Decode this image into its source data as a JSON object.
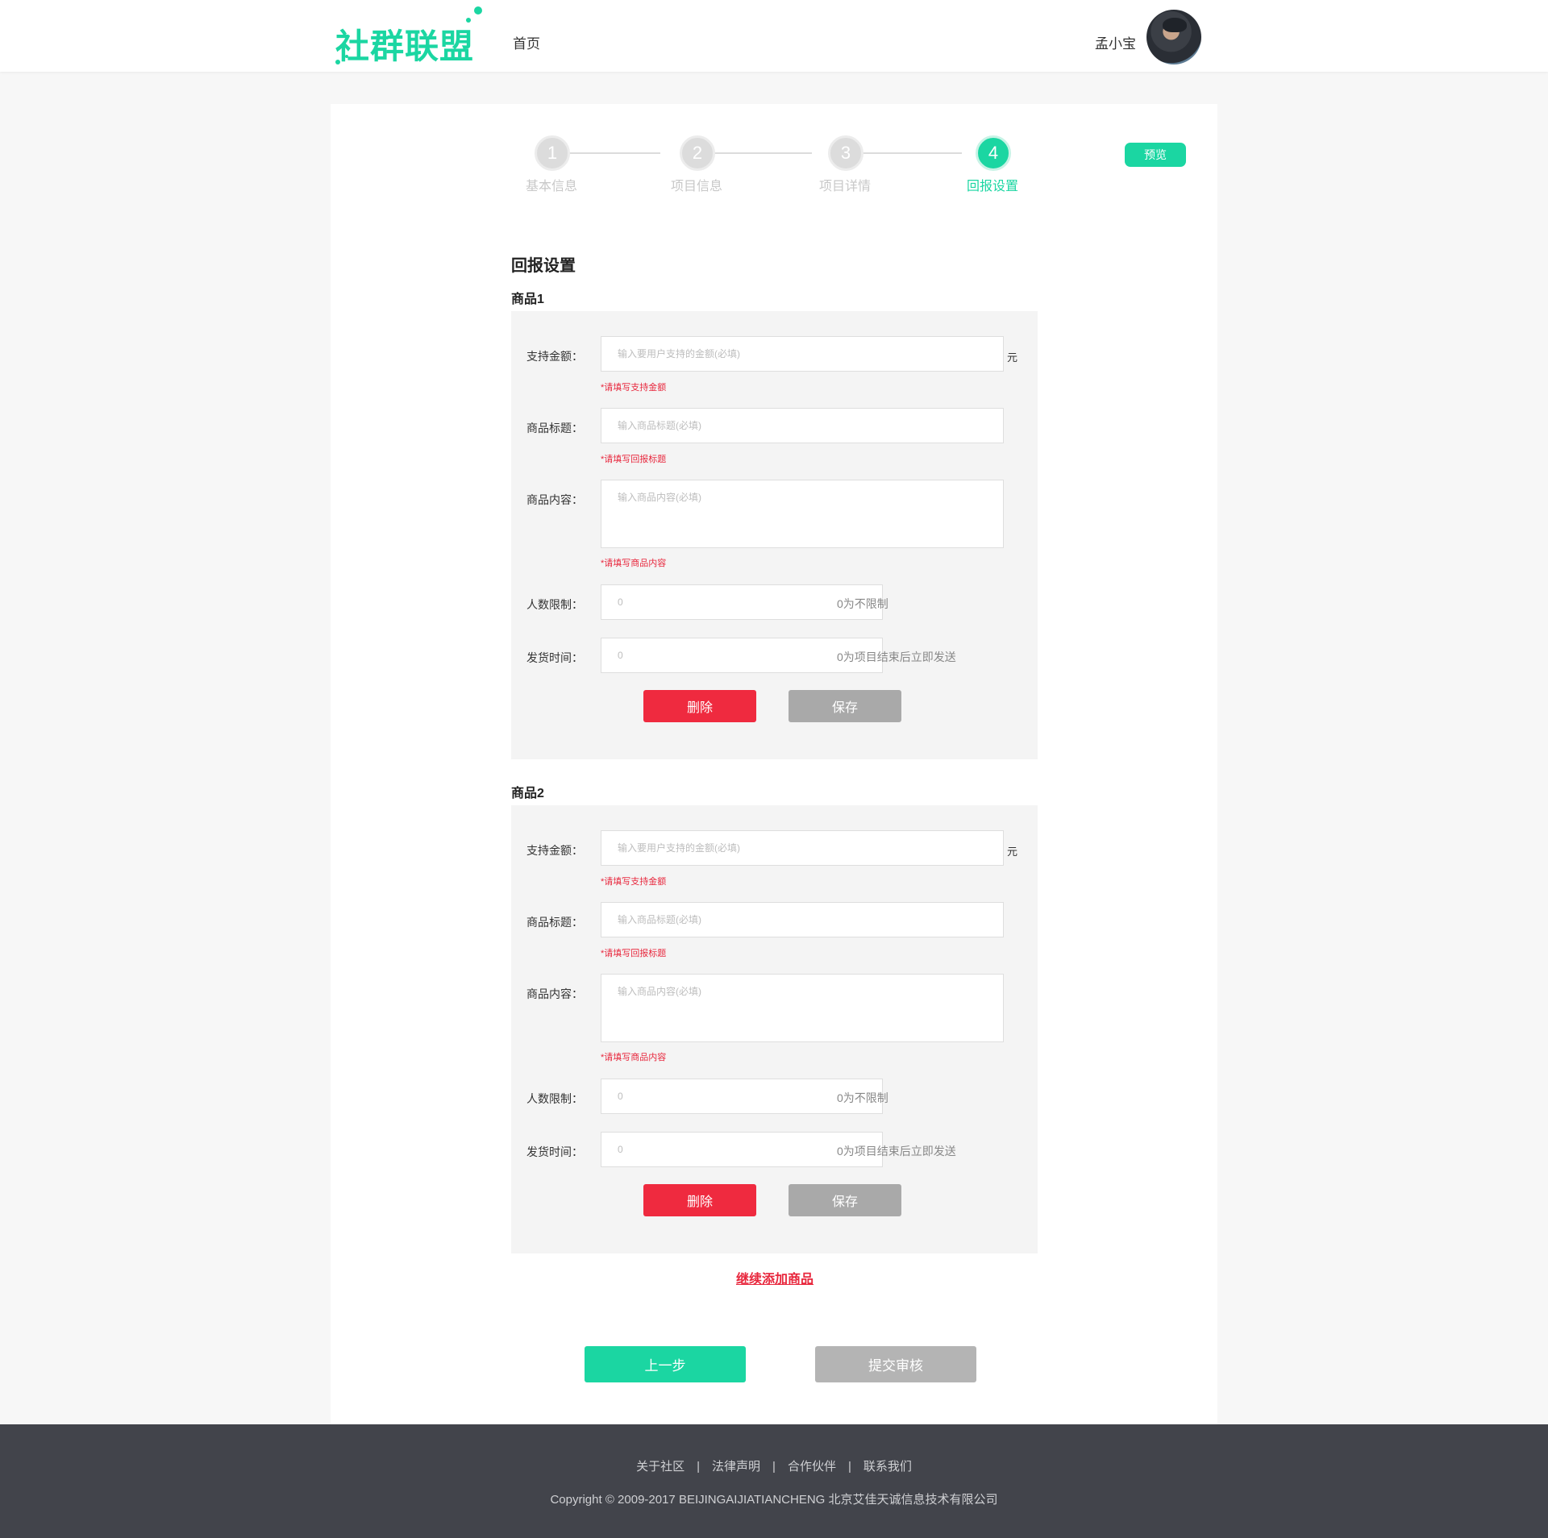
{
  "header": {
    "logo_text": "社群联盟",
    "nav_home": "首页",
    "username": "孟小宝"
  },
  "steps": [
    {
      "number": "1",
      "label": "基本信息",
      "active": false
    },
    {
      "number": "2",
      "label": "项目信息",
      "active": false
    },
    {
      "number": "3",
      "label": "项目详情",
      "active": false
    },
    {
      "number": "4",
      "label": "回报设置",
      "active": true
    }
  ],
  "preview_label": "预览",
  "section_title": "回报设置",
  "products": [
    {
      "title": "商品1",
      "amount_label": "支持金额：",
      "amount_placeholder": "输入要用户支持的金额(必填)",
      "amount_value": "",
      "amount_unit": "元",
      "amount_error": "*请填写支持金额",
      "name_label": "商品标题：",
      "name_placeholder": "输入商品标题(必填)",
      "name_value": "",
      "name_error": "*请填写回报标题",
      "content_label": "商品内容：",
      "content_placeholder": "输入商品内容(必填)",
      "content_value": "",
      "content_error": "*请填写商品内容",
      "limit_label": "人数限制：",
      "limit_placeholder": "0",
      "limit_hint": "0为不限制",
      "ship_label": "发货时间：",
      "ship_placeholder": "0",
      "ship_hint": "0为项目结束后立即发送",
      "delete_label": "删除",
      "save_label": "保存"
    },
    {
      "title": "商品2",
      "amount_label": "支持金额：",
      "amount_placeholder": "输入要用户支持的金额(必填)",
      "amount_value": "",
      "amount_unit": "元",
      "amount_error": "*请填写支持金额",
      "name_label": "商品标题：",
      "name_placeholder": "输入商品标题(必填)",
      "name_value": "",
      "name_error": "*请填写回报标题",
      "content_label": "商品内容：",
      "content_placeholder": "输入商品内容(必填)",
      "content_value": "",
      "content_error": "*请填写商品内容",
      "limit_label": "人数限制：",
      "limit_placeholder": "0",
      "limit_hint": "0为不限制",
      "ship_label": "发货时间：",
      "ship_placeholder": "0",
      "ship_hint": "0为项目结束后立即发送",
      "delete_label": "删除",
      "save_label": "保存"
    }
  ],
  "add_more_label": "继续添加商品",
  "prev_label": "上一步",
  "submit_label": "提交审核",
  "footer": {
    "links": [
      "关于社区",
      "法律声明",
      "合作伙伴",
      "联系我们"
    ],
    "separator": "|",
    "copyright": "Copyright © 2009-2017 BEIJINGAIJIATIANCHENG 北京艾佳天诚信息技术有限公司"
  },
  "colors": {
    "accent": "#1bd6a2",
    "danger": "#ef2a3f",
    "muted_button": "#a9a9a9",
    "footer_bg": "#42444b"
  }
}
